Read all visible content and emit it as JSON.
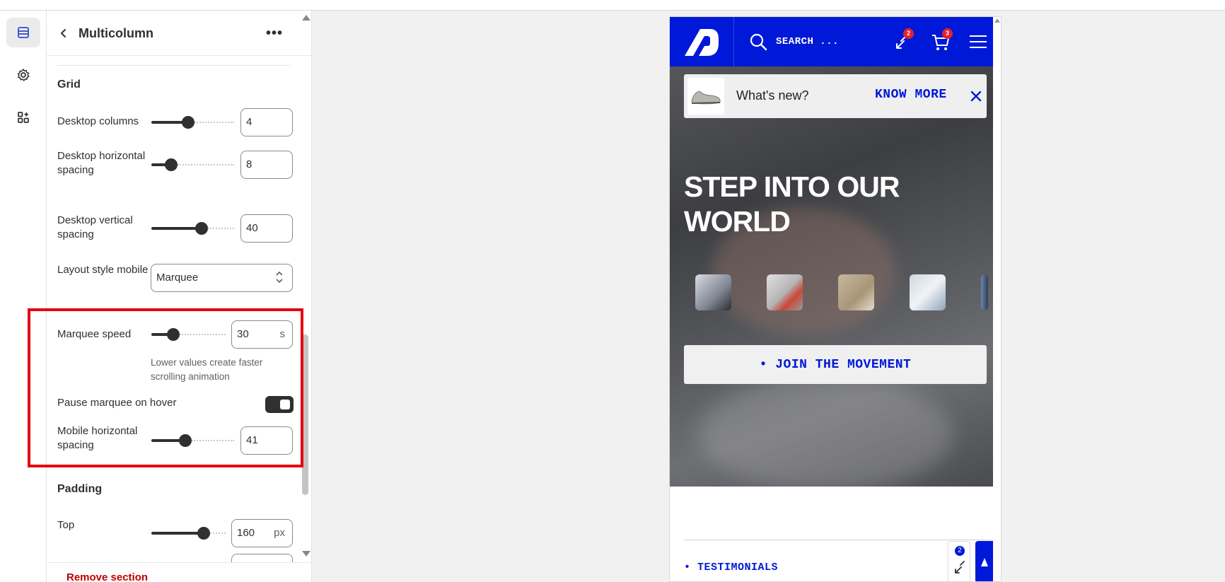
{
  "panel": {
    "title": "Multicolumn",
    "grid_title": "Grid",
    "padding_title": "Padding",
    "remove_label": "Remove section",
    "desktop_columns": {
      "label": "Desktop columns",
      "value": "4",
      "level": 0.43
    },
    "desktop_h_spacing": {
      "label": "Desktop horizontal spacing",
      "value": "8",
      "level": 0.19
    },
    "desktop_v_spacing": {
      "label": "Desktop vertical spacing",
      "value": "40",
      "level": 0.63
    },
    "layout_mobile": {
      "label": "Layout style mobile",
      "value": "Marquee"
    },
    "marquee_speed": {
      "label": "Marquee speed",
      "value": "30",
      "unit": "s",
      "help": "Lower values create faster scrolling animation",
      "level": 0.25
    },
    "pause_on_hover": {
      "label": "Pause marquee on hover",
      "on": true
    },
    "mobile_h_spacing": {
      "label": "Mobile horizontal spacing",
      "value": "41",
      "level": 0.39
    },
    "top": {
      "label": "Top",
      "value": "160",
      "unit": "px",
      "level": 0.75
    }
  },
  "preview": {
    "search_text": "SEARCH ...",
    "compare_count": "2",
    "cart_count": "3",
    "notice_text": "What's new?",
    "know_more": "KNOW MORE",
    "hero_title": "STEP INTO OUR WORLD",
    "join_button": "• JOIN THE MOVEMENT",
    "testimonials": "• TESTIMONIALS",
    "float_compare_count": "2"
  },
  "colors": {
    "brand_blue": "#0019d8",
    "highlight_red": "#e6000f",
    "badge_red": "#e5202e"
  },
  "icons": [
    "sections-icon",
    "gear-icon",
    "apps-icon",
    "chevron-left-icon",
    "more-icon",
    "search-icon",
    "compare-icon",
    "cart-icon",
    "menu-icon",
    "close-icon",
    "arrow-up-icon"
  ]
}
